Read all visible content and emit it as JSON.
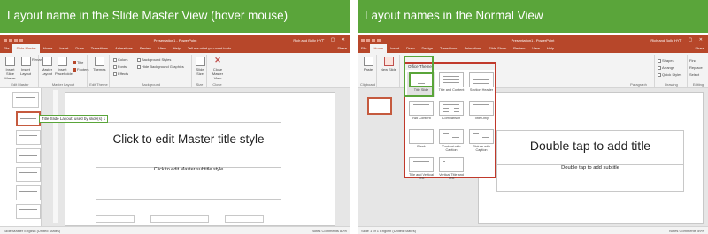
{
  "left_panel": {
    "caption": "Layout name in the Slide Master View (hover mouse)",
    "titlebar": {
      "doc_title": "Presentation1 - PowerPoint",
      "user": "Rich and Bolly HYT",
      "window_controls": "–  ▢  ✕"
    },
    "tabs": [
      "File",
      "Slide Master",
      "Home",
      "Insert",
      "Draw",
      "Transitions",
      "Animations",
      "Review",
      "View",
      "Help"
    ],
    "active_tab": "Slide Master",
    "tell_me": "Tell me what you want to do",
    "share": "Share",
    "ribbon": {
      "edit_master": {
        "buttons": [
          "Insert Slide Master",
          "Insert Layout",
          "Rename",
          "Preserve",
          "Delete"
        ],
        "group": "Edit Master"
      },
      "master_layout": {
        "buttons": [
          "Master Layout",
          "Insert Placeholder"
        ],
        "checks": [
          "Title",
          "Footers"
        ],
        "group": "Master Layout"
      },
      "edit_theme": {
        "buttons": [
          "Themes"
        ],
        "group": "Edit Theme"
      },
      "background": {
        "items": [
          "Colors",
          "Fonts",
          "Effects"
        ],
        "items2": [
          "Background Styles",
          "Hide Background Graphics"
        ],
        "group": "Background"
      },
      "size": {
        "buttons": [
          "Slide Size"
        ],
        "group": "Size"
      },
      "close": {
        "buttons": [
          "Close Master View"
        ],
        "group": "Close"
      }
    },
    "tooltip": "Title Slide Layout: used by slide(s) 1",
    "slide": {
      "title": "Click to edit Master title style",
      "subtitle": "Click to edit Master subtitle style"
    },
    "status": {
      "left": "Slide Master   English (United States)",
      "right": "Notes   Comments   80%"
    }
  },
  "right_panel": {
    "caption": "Layout names in the Normal View",
    "titlebar": {
      "doc_title": "Presentation1 - PowerPoint",
      "user": "Rich and Bolly HYT",
      "window_controls": "–  ▢  ✕"
    },
    "tabs": [
      "File",
      "Home",
      "Insert",
      "Draw",
      "Design",
      "Transitions",
      "Animations",
      "Slide Show",
      "Review",
      "View",
      "Help"
    ],
    "active_tab": "Home",
    "tell_me": "Tell me what you want to do",
    "share": "Share",
    "ribbon": {
      "left_buttons": [
        "Paste",
        "New Slide"
      ],
      "groups": [
        "Clipboard",
        "Paragraph",
        "Drawing",
        "Editing"
      ],
      "right_buttons": [
        "Shapes",
        "Arrange",
        "Quick Styles"
      ],
      "editing": [
        "Find",
        "Replace",
        "Select"
      ]
    },
    "gallery": {
      "header": "Office Theme",
      "layouts": [
        "Title Slide",
        "Title and Content",
        "Section Header",
        "Two Content",
        "Comparison",
        "Title Only",
        "Blank",
        "Content with Caption",
        "Picture with Caption",
        "Title and Vertical Text",
        "Vertical Title and Text"
      ],
      "selected": "Title Slide"
    },
    "slide": {
      "title": "Double tap to add title",
      "subtitle": "Double tap to add subtitle"
    },
    "status": {
      "left": "Slide 1 of 1   English (United States)",
      "right": "Notes   Comments   59%"
    }
  }
}
